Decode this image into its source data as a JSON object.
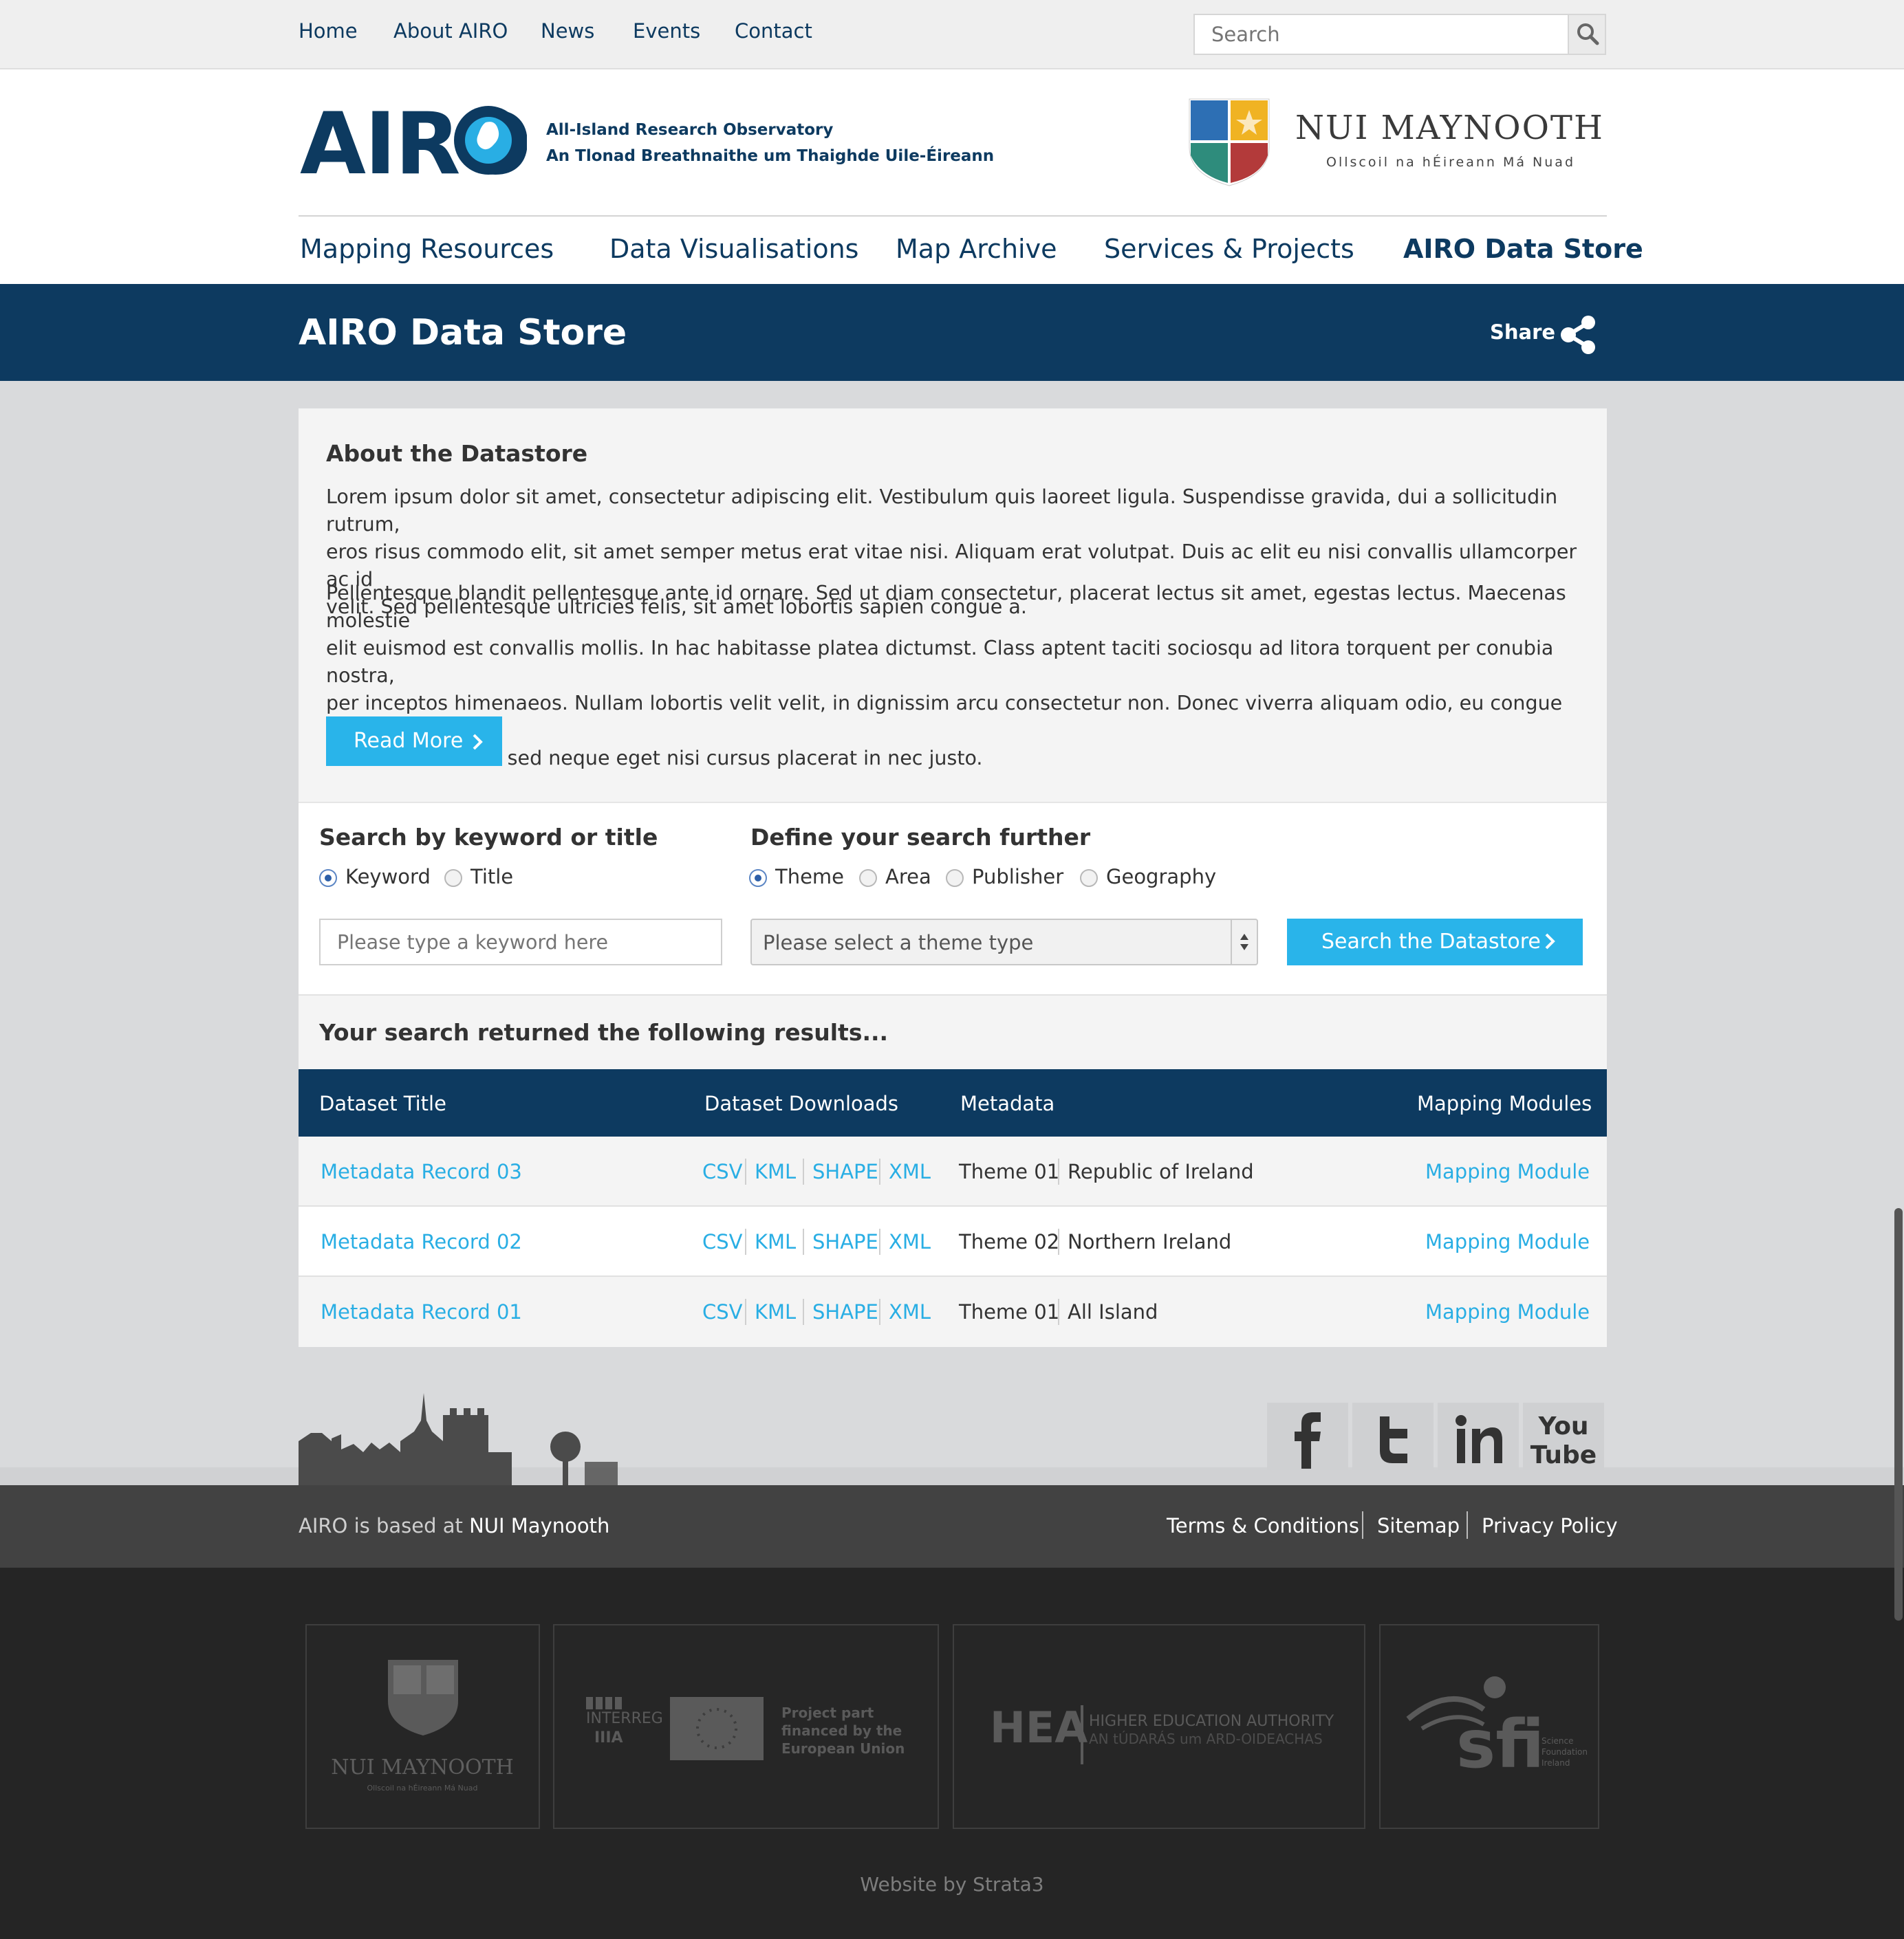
{
  "top_nav": {
    "links": [
      "Home",
      "About AIRO",
      "News",
      "Events",
      "Contact"
    ],
    "search_placeholder": "Search"
  },
  "header": {
    "logo_text": "AIRO",
    "tagline_1": "All-Island Research Observatory",
    "tagline_2": "An Tlonad Breathnaithe um Thaighde Uile-Éireann",
    "partner_name": "NUI MAYNOOTH",
    "partner_subtitle": "Ollscoil na hÉireann Má Nuad"
  },
  "main_nav": {
    "items": [
      "Mapping Resources",
      "Data Visualisations",
      "Map Archive",
      "Services & Projects",
      "AIRO Data Store"
    ],
    "active": "AIRO Data Store"
  },
  "title_bar": {
    "title": "AIRO Data Store",
    "share_label": "Share"
  },
  "about": {
    "heading": "About the Datastore",
    "para1_lines": [
      "Lorem ipsum dolor sit amet, consectetur adipiscing elit. Vestibulum quis laoreet ligula. Suspendisse gravida, dui a sollicitudin rutrum,",
      "eros risus commodo elit, sit amet semper metus erat vitae nisi. Aliquam erat volutpat. Duis ac elit eu nisi convallis ullamcorper ac id",
      "velit. Sed pellentesque ultricies felis, sit amet lobortis sapien congue a."
    ],
    "para2_lines": [
      "Pellentesque blandit pellentesque ante id ornare. Sed ut diam consectetur, placerat lectus sit amet, egestas lectus. Maecenas molestie",
      "elit euismod est convallis mollis. In hac habitasse platea dictumst. Class aptent taciti sociosqu ad litora torquent per conubia nostra,",
      "per inceptos himenaeos. Nullam lobortis velit velit, in dignissim arcu consectetur non. Donec viverra aliquam odio, eu congue magna",
      "mollis vitae. Nulla sed neque eget nisi cursus placerat in nec justo."
    ],
    "read_more_label": "Read More"
  },
  "search": {
    "keyword_heading": "Search by keyword or title",
    "keyword_options": [
      "Keyword",
      "Title"
    ],
    "keyword_selected": "Keyword",
    "keyword_placeholder": "Please type a keyword here",
    "define_heading": "Define your search further",
    "define_options": [
      "Theme",
      "Area",
      "Publisher",
      "Geography"
    ],
    "define_selected": "Theme",
    "theme_select_value": "Please select a theme type",
    "search_button_label": "Search the Datastore"
  },
  "results": {
    "heading": "Your search returned the following results...",
    "columns": [
      "Dataset Title",
      "Dataset Downloads",
      "Metadata",
      "Mapping Modules"
    ],
    "rows": [
      {
        "title": "Metadata Record 03",
        "downloads": [
          "CSV",
          "KML",
          "SHAPE",
          "XML"
        ],
        "theme": "Theme 01",
        "area": "Republic of Ireland",
        "module": "Mapping Module"
      },
      {
        "title": "Metadata Record 02",
        "downloads": [
          "CSV",
          "KML",
          "SHAPE",
          "XML"
        ],
        "theme": "Theme 02",
        "area": "Northern Ireland",
        "module": "Mapping Module"
      },
      {
        "title": "Metadata Record 01",
        "downloads": [
          "CSV",
          "KML",
          "SHAPE",
          "XML"
        ],
        "theme": "Theme 01",
        "area": "All Island",
        "module": "Mapping Module"
      }
    ]
  },
  "footer": {
    "social_icons": [
      "facebook-icon",
      "twitter-icon",
      "linkedin-icon",
      "youtube-icon"
    ],
    "youtube_text_1": "You",
    "youtube_text_2": "Tube",
    "based_prefix": "AIRO is based at",
    "based_link": "NUI Maynooth",
    "links": [
      "Terms & Conditions",
      "Sitemap",
      "Privacy Policy"
    ],
    "partners": {
      "nui_name": "NUI MAYNOOTH",
      "nui_sub": "Ollscoil na hÉireann Má Nuad",
      "interreg": "INTERREG",
      "interreg_num": "IIIA",
      "eu_lines": [
        "Project part",
        "financed by the",
        "European Union"
      ],
      "hea": "HEA",
      "hea_line1": "HIGHER EDUCATION AUTHORITY",
      "hea_line2": "AN tÚDARÁS um ARD-OIDEACHAS",
      "sfi": "sfi",
      "sfi_lines": [
        "Science",
        "Foundation",
        "Ireland"
      ]
    },
    "credit": "Website by Strata3"
  },
  "colors": {
    "navy": "#0d3a60",
    "accent_blue": "#29b4ea",
    "link_blue": "#29aee4",
    "footer_mid": "#424242",
    "footer_dark": "#252525"
  }
}
